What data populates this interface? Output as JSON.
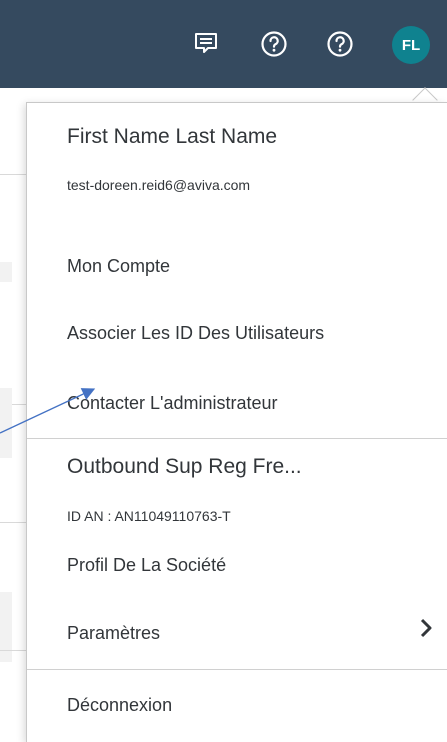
{
  "user": {
    "initials": "FL",
    "name": "First Name Last Name",
    "email": "test-doreen.reid6@aviva.com"
  },
  "menu": {
    "my_account": "Mon Compte",
    "link_user_ids": "Associer Les ID Des Utilisateurs",
    "contact_admin": "Contacter L'administrateur",
    "company_name": "Outbound Sup Reg Fre...",
    "an_id": "ID AN : AN11049110763-T",
    "company_profile": "Profil De La Société",
    "settings": "Paramètres",
    "logout": "Déconnexion"
  },
  "icons": {
    "feedback": "feedback-icon",
    "help": "help-icon",
    "chevron": "chevron-right-icon"
  },
  "colors": {
    "header_bg": "#354a5f",
    "avatar_bg": "#0f828f",
    "annotation_arrow": "#4472c4"
  }
}
